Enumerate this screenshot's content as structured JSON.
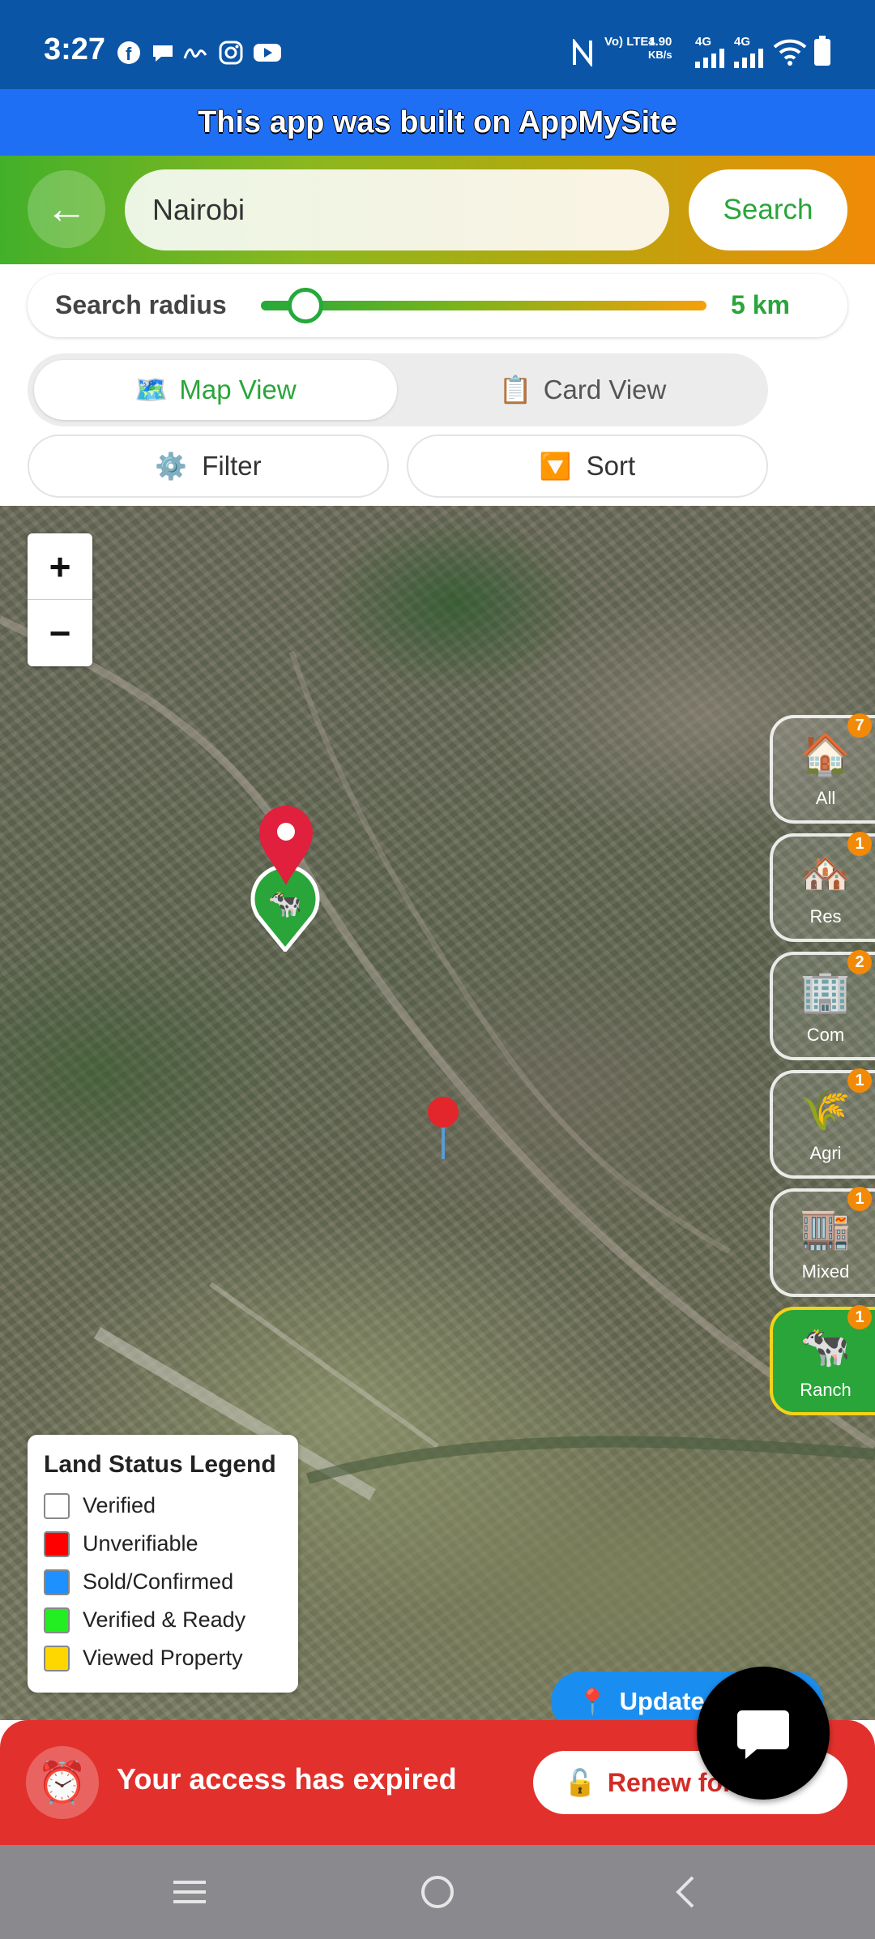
{
  "status_bar": {
    "time": "3:27",
    "app_icons": [
      "facebook-icon",
      "chat-bubble-icon",
      "signature-icon",
      "instagram-icon",
      "youtube-icon"
    ],
    "network": {
      "volte": "Vo) LTE1",
      "speed_value": "4.90",
      "speed_unit": "KB/s",
      "net1": "4G",
      "net2": "4G"
    }
  },
  "banner": {
    "text": "This app was built on AppMySite"
  },
  "header": {
    "search_value": "Nairobi",
    "search_button": "Search"
  },
  "radius": {
    "label": "Search radius",
    "value": "5 km",
    "level_fraction": 0.1
  },
  "view_toggle": {
    "map_view": {
      "icon": "🗺️",
      "label": "Map View",
      "active": true
    },
    "card_view": {
      "icon": "📋",
      "label": "Card View",
      "active": false
    }
  },
  "actions": {
    "filter": {
      "icon": "⚙️",
      "label": "Filter"
    },
    "sort": {
      "icon": "🔽",
      "label": "Sort"
    }
  },
  "zoom": {
    "in": "+",
    "out": "−"
  },
  "categories": [
    {
      "label": "All",
      "icon": "🏠",
      "count": "7"
    },
    {
      "label": "Res",
      "icon": "🏘️",
      "count": "1"
    },
    {
      "label": "Com",
      "icon": "🏢",
      "count": "2"
    },
    {
      "label": "Agri",
      "icon": "🌾",
      "count": "1"
    },
    {
      "label": "Mixed",
      "icon": "🏬",
      "count": "1"
    },
    {
      "label": "Ranch",
      "icon": "🐄",
      "count": "1"
    }
  ],
  "legend": {
    "title": "Land Status Legend",
    "items": [
      {
        "label": "Verified",
        "color": "#ffffff"
      },
      {
        "label": "Unverifiable",
        "color": "#ff0000"
      },
      {
        "label": "Sold/Confirmed",
        "color": "#1e90ff"
      },
      {
        "label": "Verified & Ready",
        "color": "#22ee22"
      },
      {
        "label": "Viewed Property",
        "color": "#ffd700"
      }
    ]
  },
  "update_button": {
    "icon": "📍",
    "label": "Update"
  },
  "expired": {
    "icon": "⏰",
    "message": "Your access has expired",
    "renew_icon": "🔓",
    "renew_label": "Renew for days"
  },
  "colors": {
    "brand_green": "#2aa53a",
    "accent_orange": "#f28a07",
    "alert_red": "#e2312c",
    "status_bar": "#0a55a6",
    "banner": "#1f6ff5"
  }
}
